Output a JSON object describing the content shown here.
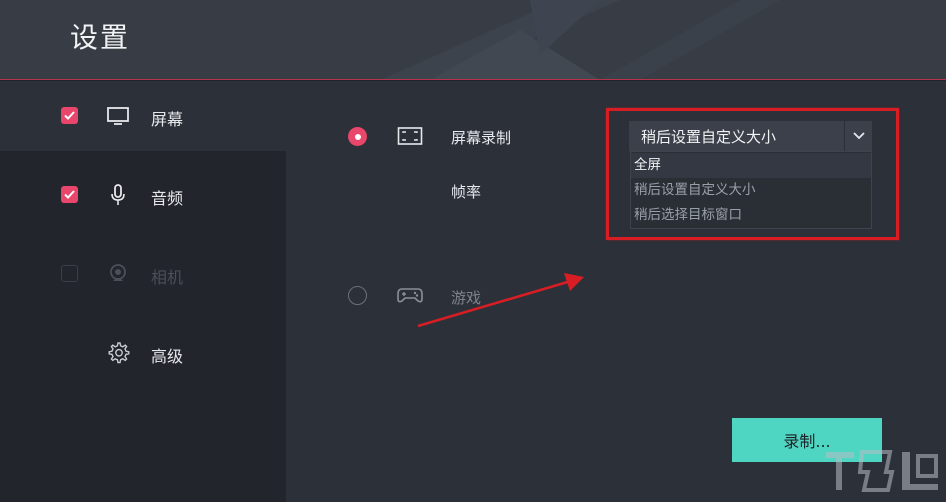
{
  "header": {
    "title": "设置"
  },
  "sidebar": {
    "items": [
      {
        "label": "屏幕",
        "checked": true,
        "icon": "monitor-icon"
      },
      {
        "label": "音频",
        "checked": true,
        "icon": "microphone-icon"
      },
      {
        "label": "相机",
        "checked": false,
        "icon": "webcam-icon",
        "disabled": true
      },
      {
        "label": "高级",
        "icon": "gear-icon"
      }
    ]
  },
  "main": {
    "screen_record": {
      "label": "屏幕录制",
      "selected": true,
      "icon": "fullscreen-frame-icon"
    },
    "frame_rate": {
      "label": "帧率"
    },
    "game": {
      "label": "游戏",
      "selected": false,
      "icon": "gamepad-icon"
    },
    "capture_dropdown": {
      "value": "稍后设置自定义大小",
      "options": [
        "全屏",
        "稍后设置自定义大小",
        "稍后选择目标窗口"
      ],
      "highlighted": "全屏"
    },
    "record_button": "录制..."
  },
  "colors": {
    "accent": "#e8466a",
    "record_button": "#4fd6c3",
    "annotation_red": "#d81e24"
  }
}
